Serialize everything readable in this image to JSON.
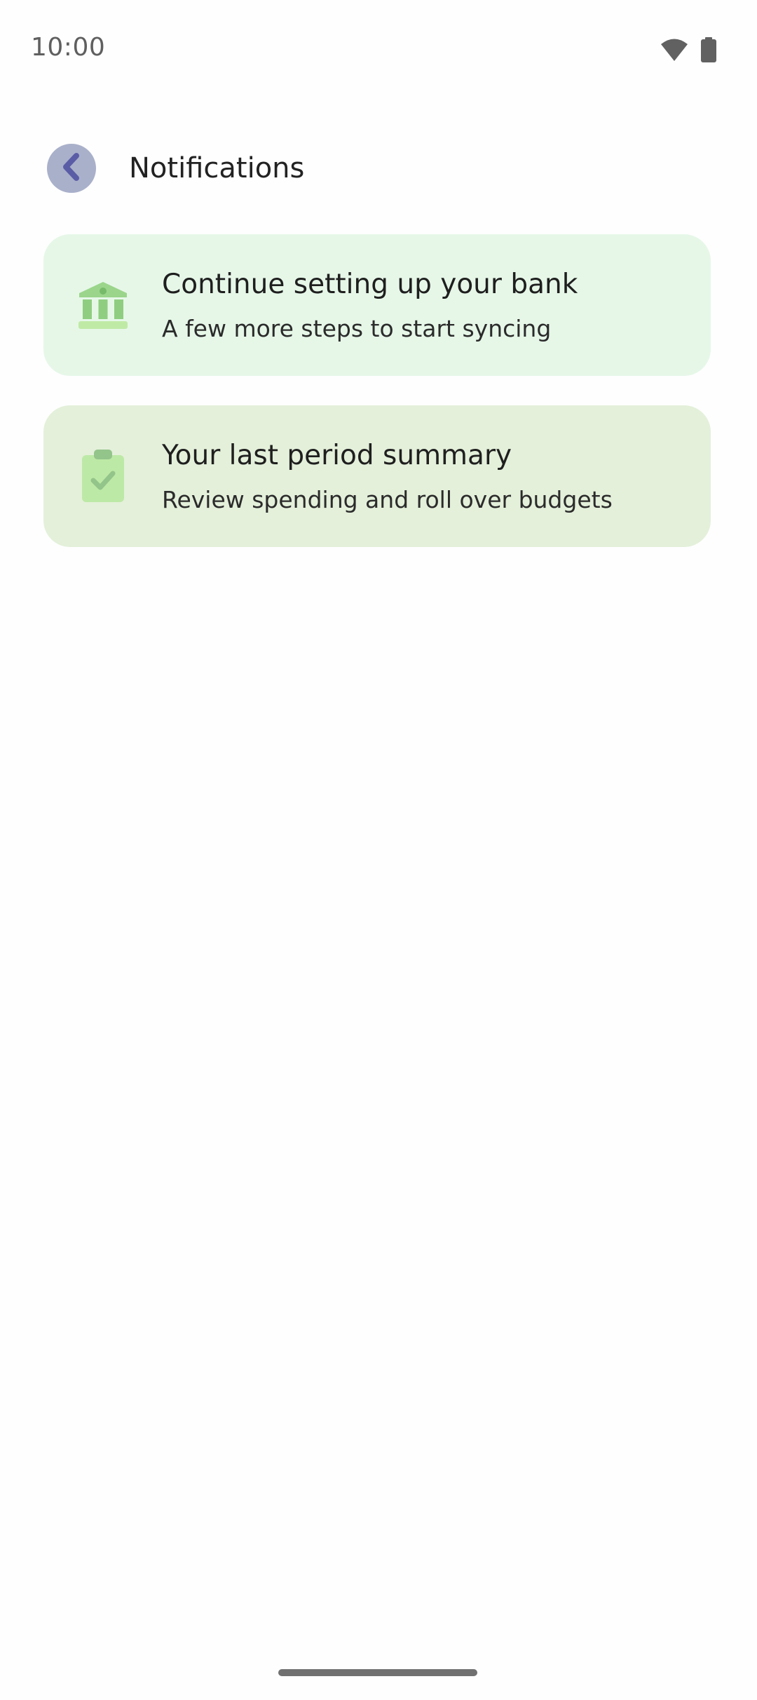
{
  "status_bar": {
    "time": "10:00",
    "icons": [
      "wifi-icon",
      "battery-icon"
    ]
  },
  "header": {
    "back_icon": "chevron-left-icon",
    "title": "Notifications"
  },
  "notifications": [
    {
      "icon": "bank-icon",
      "title": "Continue setting up your bank",
      "subtitle": "A few more steps to start syncing",
      "background": "#e6f7e8"
    },
    {
      "icon": "clipboard-check-icon",
      "title": "Your last period summary",
      "subtitle": "Review spending and roll over budgets",
      "background": "#e4f0da"
    }
  ],
  "colors": {
    "back_button_bg": "#a9b0ca",
    "back_chevron": "#5a5ca6",
    "icon_green": "#8fce80",
    "icon_green_light": "#bfeaa6"
  }
}
